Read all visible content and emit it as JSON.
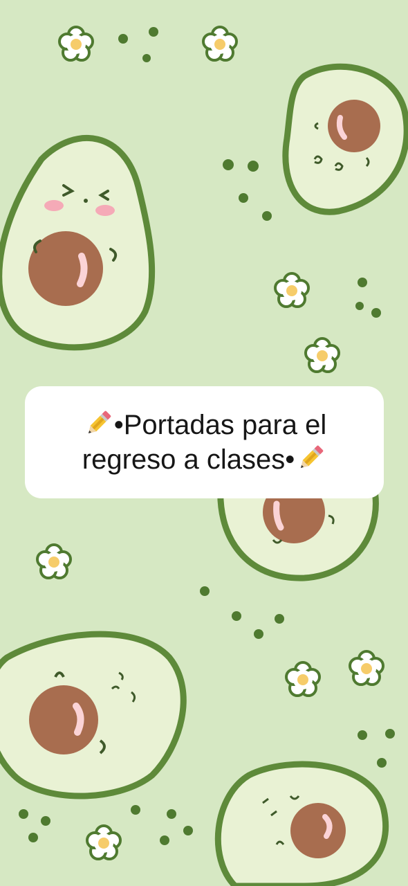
{
  "caption": {
    "line1": "•Portadas para el",
    "line2": "regreso a clases•"
  },
  "icons": {
    "leading": "pencil-icon",
    "trailing": "pencil-icon"
  },
  "colors": {
    "background": "#d6e8c3",
    "avocado_outline": "#5e8a3a",
    "avocado_flesh": "#e9f2d4",
    "pit": "#a86d4f",
    "card": "#ffffff",
    "text": "#161616"
  }
}
